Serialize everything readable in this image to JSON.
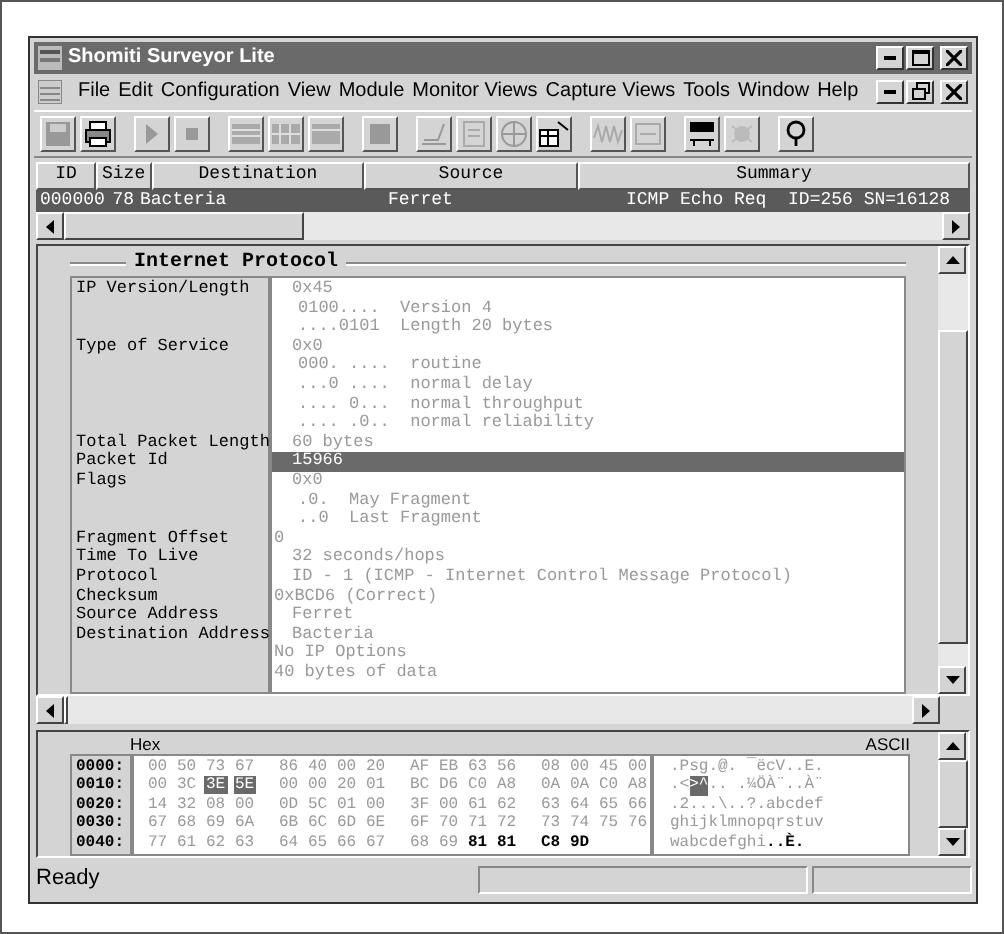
{
  "window": {
    "title": "Shomiti Surveyor Lite"
  },
  "menu": [
    "File",
    "Edit",
    "Configuration",
    "View",
    "Module",
    "Monitor Views",
    "Capture Views",
    "Tools",
    "Window",
    "Help"
  ],
  "packet_list": {
    "columns": [
      "ID",
      "Size",
      "Destination",
      "Source",
      "Summary"
    ],
    "rows": [
      {
        "id": "000000",
        "size": "78",
        "destination": "Bacteria",
        "source": "Ferret",
        "summary": "ICMP Echo Req  ID=256 SN=16128",
        "selected": true
      }
    ]
  },
  "detail": {
    "heading": "Internet Protocol",
    "rows": [
      {
        "label": "IP Version/Length",
        "value": "0x45",
        "kind": "value",
        "selected": false
      },
      {
        "value": "0100....  Version 4",
        "kind": "bits",
        "selected": false
      },
      {
        "value": "....0101  Length 20 bytes",
        "kind": "bits",
        "selected": false
      },
      {
        "label": "Type of Service",
        "value": "0x0",
        "kind": "value",
        "selected": false
      },
      {
        "value": "000. ....  routine",
        "kind": "bits",
        "selected": false
      },
      {
        "value": "...0 ....  normal delay",
        "kind": "bits",
        "selected": false
      },
      {
        "value": ".... 0...  normal throughput",
        "kind": "bits",
        "selected": false
      },
      {
        "value": ".... .0..  normal reliability",
        "kind": "bits",
        "selected": false
      },
      {
        "label": "Total Packet Length",
        "value": "60 bytes",
        "kind": "value",
        "selected": false
      },
      {
        "label": "Packet Id",
        "value": "15966",
        "kind": "value",
        "selected": true
      },
      {
        "label": "Flags",
        "value": "0x0",
        "kind": "value",
        "selected": false
      },
      {
        "value": ".0.  May Fragment",
        "kind": "bits",
        "selected": false
      },
      {
        "value": "..0  Last Fragment",
        "kind": "bits",
        "selected": false
      },
      {
        "label": "Fragment Offset",
        "value": "0",
        "kind": "flush",
        "selected": false
      },
      {
        "label": "Time To Live",
        "value": "32 seconds/hops",
        "kind": "value",
        "selected": false
      },
      {
        "label": "Protocol",
        "value": "ID - 1 (ICMP - Internet Control Message Protocol)",
        "kind": "value",
        "selected": false
      },
      {
        "label": "Checksum",
        "value": "0xBCD6 (Correct)",
        "kind": "flush",
        "selected": false
      },
      {
        "label": "Source Address",
        "value": "Ferret",
        "kind": "value",
        "selected": false
      },
      {
        "label": "Destination Address",
        "value": "Bacteria",
        "kind": "value",
        "selected": false
      },
      {
        "value": "No IP Options",
        "kind": "flush",
        "selected": false
      },
      {
        "value": "40 bytes of data",
        "kind": "flush",
        "selected": false
      }
    ]
  },
  "hex": {
    "hex_label": "Hex",
    "ascii_label": "ASCII",
    "rows": [
      {
        "offset": "0000:",
        "bytes": [
          {
            "text": "00",
            "kind": "normal"
          },
          {
            "text": "50",
            "kind": "normal"
          },
          {
            "text": "73",
            "kind": "normal"
          },
          {
            "text": "67",
            "kind": "normal"
          },
          {
            "text": "86",
            "kind": "normal"
          },
          {
            "text": "40",
            "kind": "normal"
          },
          {
            "text": "00",
            "kind": "normal"
          },
          {
            "text": "20",
            "kind": "normal"
          },
          {
            "text": "AF",
            "kind": "normal"
          },
          {
            "text": "EB",
            "kind": "normal"
          },
          {
            "text": "63",
            "kind": "normal"
          },
          {
            "text": "56",
            "kind": "normal"
          },
          {
            "text": "08",
            "kind": "normal"
          },
          {
            "text": "00",
            "kind": "normal"
          },
          {
            "text": "45",
            "kind": "normal"
          },
          {
            "text": "00",
            "kind": "normal"
          }
        ],
        "ascii": [
          {
            "text": ".Psg.@. ¯ëcV..E.",
            "kind": "normal"
          }
        ]
      },
      {
        "offset": "0010:",
        "bytes": [
          {
            "text": "00",
            "kind": "normal"
          },
          {
            "text": "3C",
            "kind": "normal"
          },
          {
            "text": "3E",
            "kind": "selected"
          },
          {
            "text": "5E",
            "kind": "selected"
          },
          {
            "text": "00",
            "kind": "normal"
          },
          {
            "text": "00",
            "kind": "normal"
          },
          {
            "text": "20",
            "kind": "normal"
          },
          {
            "text": "01",
            "kind": "normal"
          },
          {
            "text": "BC",
            "kind": "normal"
          },
          {
            "text": "D6",
            "kind": "normal"
          },
          {
            "text": "C0",
            "kind": "normal"
          },
          {
            "text": "A8",
            "kind": "normal"
          },
          {
            "text": "0A",
            "kind": "normal"
          },
          {
            "text": "0A",
            "kind": "normal"
          },
          {
            "text": "C0",
            "kind": "normal"
          },
          {
            "text": "A8",
            "kind": "normal"
          }
        ],
        "ascii": [
          {
            "text": ".<",
            "kind": "normal"
          },
          {
            "text": ">^",
            "kind": "selected"
          },
          {
            "text": ".. .¼ÖÀ¨..À¨",
            "kind": "normal"
          }
        ]
      },
      {
        "offset": "0020:",
        "bytes": [
          {
            "text": "14",
            "kind": "normal"
          },
          {
            "text": "32",
            "kind": "normal"
          },
          {
            "text": "08",
            "kind": "normal"
          },
          {
            "text": "00",
            "kind": "normal"
          },
          {
            "text": "0D",
            "kind": "normal"
          },
          {
            "text": "5C",
            "kind": "normal"
          },
          {
            "text": "01",
            "kind": "normal"
          },
          {
            "text": "00",
            "kind": "normal"
          },
          {
            "text": "3F",
            "kind": "normal"
          },
          {
            "text": "00",
            "kind": "normal"
          },
          {
            "text": "61",
            "kind": "normal"
          },
          {
            "text": "62",
            "kind": "normal"
          },
          {
            "text": "63",
            "kind": "normal"
          },
          {
            "text": "64",
            "kind": "normal"
          },
          {
            "text": "65",
            "kind": "normal"
          },
          {
            "text": "66",
            "kind": "normal"
          }
        ],
        "ascii": [
          {
            "text": ".2...\\..?.abcdef",
            "kind": "normal"
          }
        ]
      },
      {
        "offset": "0030:",
        "bytes": [
          {
            "text": "67",
            "kind": "normal"
          },
          {
            "text": "68",
            "kind": "normal"
          },
          {
            "text": "69",
            "kind": "normal"
          },
          {
            "text": "6A",
            "kind": "normal"
          },
          {
            "text": "6B",
            "kind": "normal"
          },
          {
            "text": "6C",
            "kind": "normal"
          },
          {
            "text": "6D",
            "kind": "normal"
          },
          {
            "text": "6E",
            "kind": "normal"
          },
          {
            "text": "6F",
            "kind": "normal"
          },
          {
            "text": "70",
            "kind": "normal"
          },
          {
            "text": "71",
            "kind": "normal"
          },
          {
            "text": "72",
            "kind": "normal"
          },
          {
            "text": "73",
            "kind": "normal"
          },
          {
            "text": "74",
            "kind": "normal"
          },
          {
            "text": "75",
            "kind": "normal"
          },
          {
            "text": "76",
            "kind": "normal"
          }
        ],
        "ascii": [
          {
            "text": "ghijklmnopqrstuv",
            "kind": "normal"
          }
        ]
      },
      {
        "offset": "0040:",
        "bytes": [
          {
            "text": "77",
            "kind": "normal"
          },
          {
            "text": "61",
            "kind": "normal"
          },
          {
            "text": "62",
            "kind": "normal"
          },
          {
            "text": "63",
            "kind": "normal"
          },
          {
            "text": "64",
            "kind": "normal"
          },
          {
            "text": "65",
            "kind": "normal"
          },
          {
            "text": "66",
            "kind": "normal"
          },
          {
            "text": "67",
            "kind": "normal"
          },
          {
            "text": "68",
            "kind": "normal"
          },
          {
            "text": "69",
            "kind": "normal"
          },
          {
            "text": "81",
            "kind": "bold"
          },
          {
            "text": "81",
            "kind": "bold"
          },
          {
            "text": "C8",
            "kind": "bold"
          },
          {
            "text": "9D",
            "kind": "bold"
          }
        ],
        "ascii": [
          {
            "text": "wabcdefghi",
            "kind": "normal"
          },
          {
            "text": "..È.",
            "kind": "bold"
          }
        ]
      }
    ]
  },
  "status_bar": {
    "text": "Ready"
  }
}
